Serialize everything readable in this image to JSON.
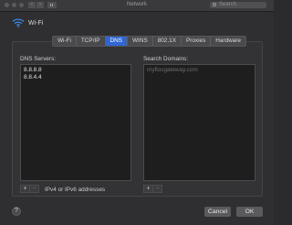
{
  "window": {
    "title": "Network",
    "search_placeholder": "Search"
  },
  "header": {
    "interface": "Wi-Fi"
  },
  "tabs": [
    "Wi-Fi",
    "TCP/IP",
    "DNS",
    "WINS",
    "802.1X",
    "Proxies",
    "Hardware"
  ],
  "active_tab": "DNS",
  "dns": {
    "servers_label": "DNS Servers:",
    "servers": [
      "8.8.8.8",
      "8.8.4.4"
    ],
    "hint": "IPv4 or IPv6 addresses"
  },
  "search_domains": {
    "label": "Search Domains:",
    "placeholder": "myfiosgateway.com"
  },
  "controls": {
    "add": "+",
    "remove": "−"
  },
  "buttons": {
    "help": "?",
    "cancel": "Cancel",
    "ok": "OK"
  },
  "colors": {
    "accent": "#2f66d2"
  }
}
